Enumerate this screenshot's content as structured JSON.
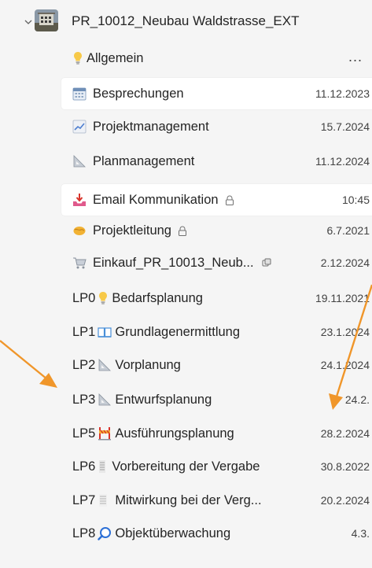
{
  "team": {
    "name": "PR_10012_Neubau Waldstrasse_EXT"
  },
  "channels": [
    {
      "name": "Allgemein",
      "icon": "lightbulb-icon",
      "date": "",
      "more": "...",
      "lock": false,
      "prefix": ""
    },
    {
      "name": "Besprechungen",
      "icon": "calendar-icon",
      "date": "11.12.2023",
      "lock": false,
      "prefix": ""
    },
    {
      "name": "Projektmanagement",
      "icon": "chart-line-icon",
      "date": "15.7.2024",
      "lock": false,
      "prefix": ""
    },
    {
      "name": "Planmanagement",
      "icon": "triangle-ruler-icon",
      "date": "11.12.2024",
      "lock": false,
      "prefix": ""
    },
    {
      "name": "Email Kommunikation",
      "icon": "inbox-tray-icon",
      "date": "10:45",
      "lock": true,
      "prefix": ""
    },
    {
      "name": "Projektleitung",
      "icon": "handshake-icon",
      "date": "6.7.2021",
      "lock": true,
      "prefix": ""
    },
    {
      "name": "Einkauf_PR_10013_Neub...",
      "icon": "shopping-cart-icon",
      "date": "2.12.2024",
      "lock": false,
      "shared": true,
      "prefix": ""
    },
    {
      "name": "Bedarfsplanung",
      "icon": "lightbulb-icon",
      "date": "19.11.2021",
      "lock": false,
      "prefix": "LP0"
    },
    {
      "name": "Grundlagenermittlung",
      "icon": "open-book-icon",
      "date": "23.1.2024",
      "lock": false,
      "prefix": "LP1"
    },
    {
      "name": "Vorplanung",
      "icon": "triangle-ruler-icon",
      "date": "24.1.2024",
      "lock": false,
      "prefix": "LP2"
    },
    {
      "name": "Entwurfsplanung",
      "icon": "triangle-ruler-icon",
      "date": "24.2.",
      "lock": false,
      "prefix": "LP3"
    },
    {
      "name": "Ausführungsplanung",
      "icon": "construction-icon",
      "date": "28.2.2024",
      "lock": false,
      "prefix": "LP5"
    },
    {
      "name": "Vorbereitung der Vergabe",
      "icon": "document-lines-icon",
      "date": "30.8.2022",
      "lock": false,
      "prefix": "LP6"
    },
    {
      "name": "Mitwirkung bei der Verg...",
      "icon": "document-lines-icon",
      "date": "20.2.2024",
      "lock": false,
      "prefix": "LP7"
    },
    {
      "name": "Objektüberwachung",
      "icon": "magnifier-icon",
      "date": "4.3.",
      "lock": false,
      "prefix": "LP8"
    }
  ],
  "colors": {
    "background": "#f5f5f5",
    "selected_row": "#ffffff",
    "arrow": "#f0962a"
  }
}
